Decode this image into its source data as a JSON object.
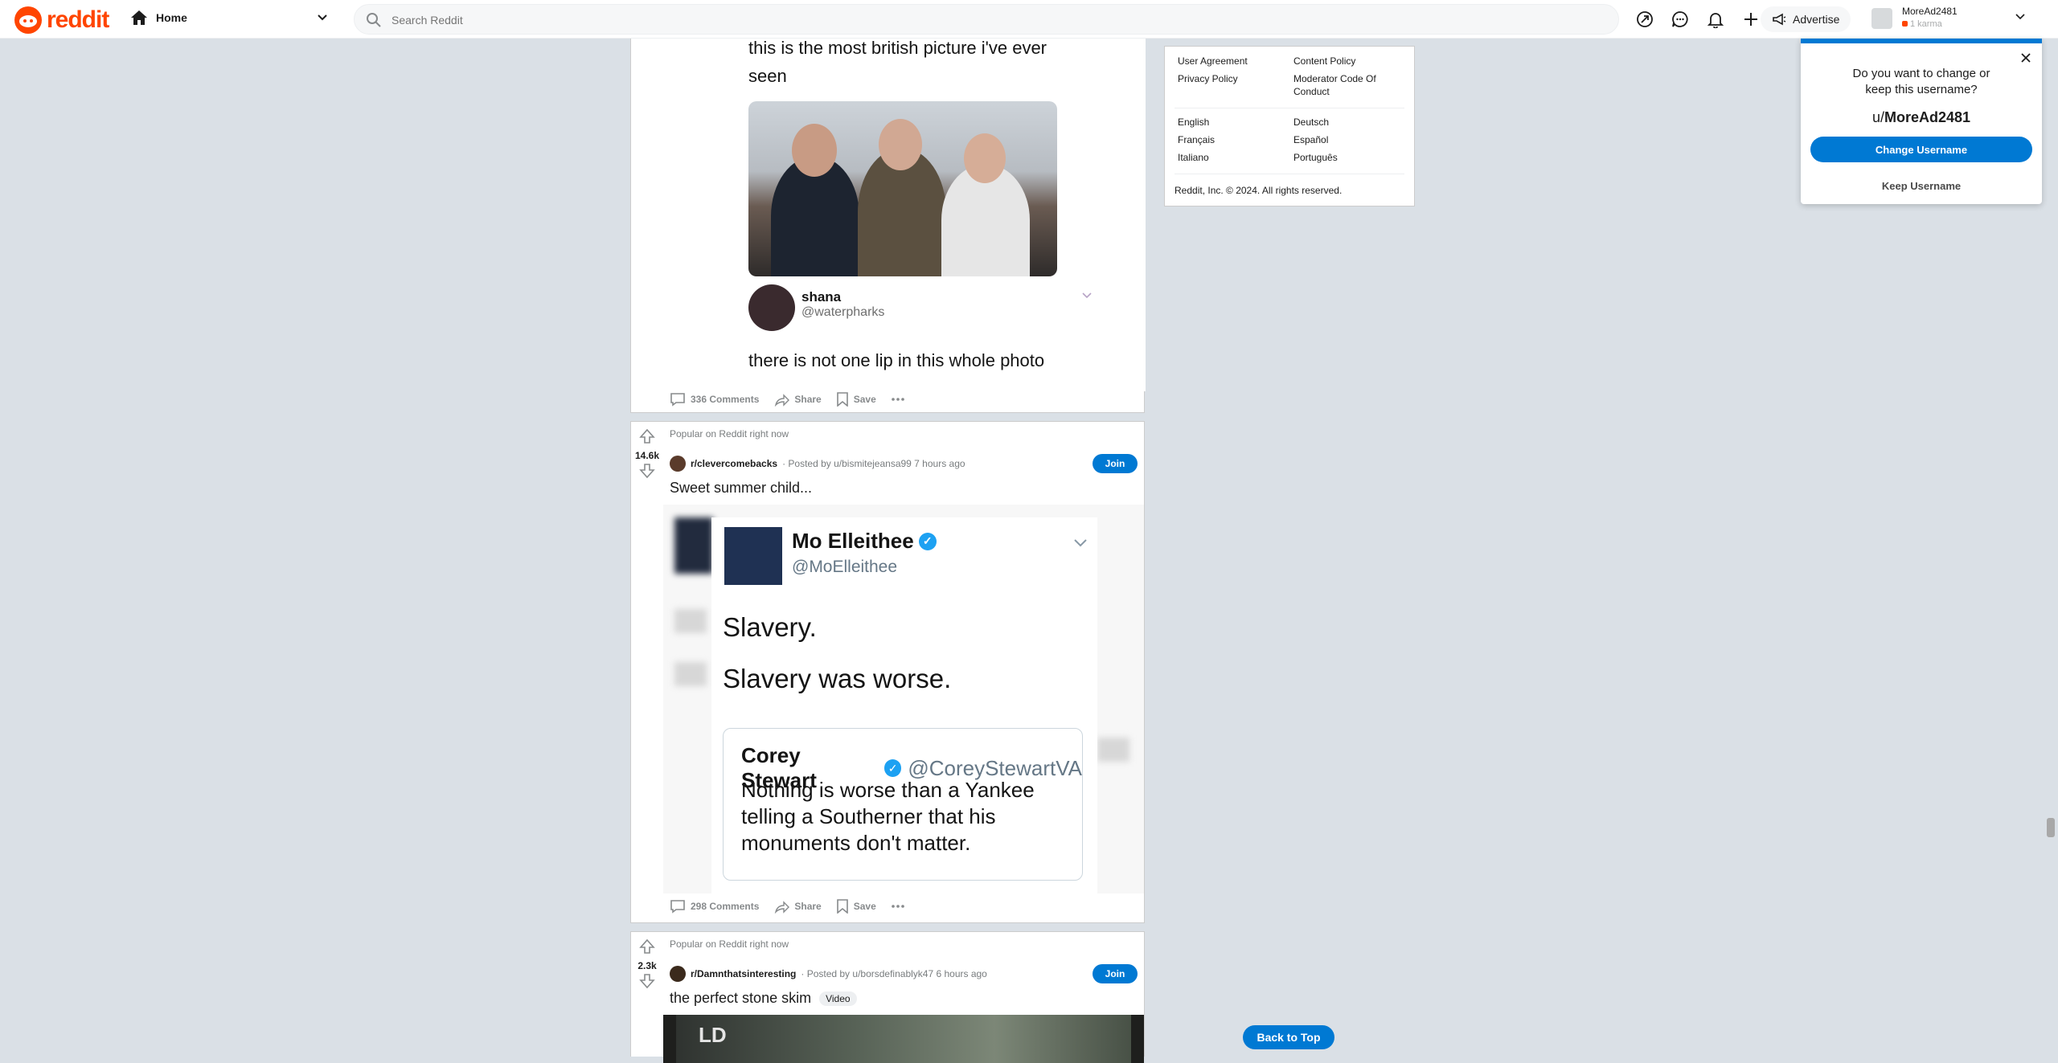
{
  "header": {
    "logo_text": "reddit",
    "home_label": "Home",
    "search_placeholder": "Search Reddit",
    "advertise_label": "Advertise",
    "username": "MoreAd2481",
    "karma": "1 karma"
  },
  "posts": [
    {
      "tweet_text": "this is the most british picture i've ever seen",
      "reply_name": "shana",
      "reply_handle": "@waterpharks",
      "reply_text": "there is not one lip in this whole photo",
      "comments": "336 Comments",
      "share": "Share",
      "save": "Save"
    },
    {
      "popular_note": "Popular on Reddit right now",
      "votes": "14.6k",
      "subreddit": "r/clevercomebacks",
      "posted_by": "· Posted by u/bismitejeansa99 7 hours ago",
      "join": "Join",
      "title": "Sweet summer child...",
      "tweet_name": "Mo Elleithee",
      "tweet_handle": "@MoElleithee",
      "tweet_line1": "Slavery.",
      "tweet_line2": "Slavery was worse.",
      "quote_name": "Corey Stewart",
      "quote_handle": "@CoreyStewartVA",
      "quote_text": "Nothing is worse than a Yankee telling a Southerner that his monuments don't matter.",
      "comments": "298 Comments",
      "share": "Share",
      "save": "Save"
    },
    {
      "popular_note": "Popular on Reddit right now",
      "votes": "2.3k",
      "subreddit": "r/Damnthatsinteresting",
      "posted_by": "· Posted by u/borsdefinablyk47 6 hours ago",
      "join": "Join",
      "title": "the perfect stone skim",
      "flair": "Video",
      "video_text": "LD"
    }
  ],
  "footer": {
    "links_col1": [
      "User Agreement",
      "Privacy Policy"
    ],
    "links_col2": [
      "Content Policy",
      "Moderator Code Of Conduct"
    ],
    "langs_col1": [
      "English",
      "Français",
      "Italiano"
    ],
    "langs_col2": [
      "Deutsch",
      "Español",
      "Português"
    ],
    "copyright": "Reddit, Inc. © 2024. All rights reserved."
  },
  "popup": {
    "question_line1": "Do you want to change or",
    "question_line2": "keep this username?",
    "prefix": "u/",
    "username": "MoreAd2481",
    "change": "Change Username",
    "keep": "Keep Username"
  },
  "back_to_top": "Back to Top",
  "colors": {
    "brand": "#ff4500",
    "accent": "#0079d3",
    "page_bg": "#dae0e6"
  }
}
